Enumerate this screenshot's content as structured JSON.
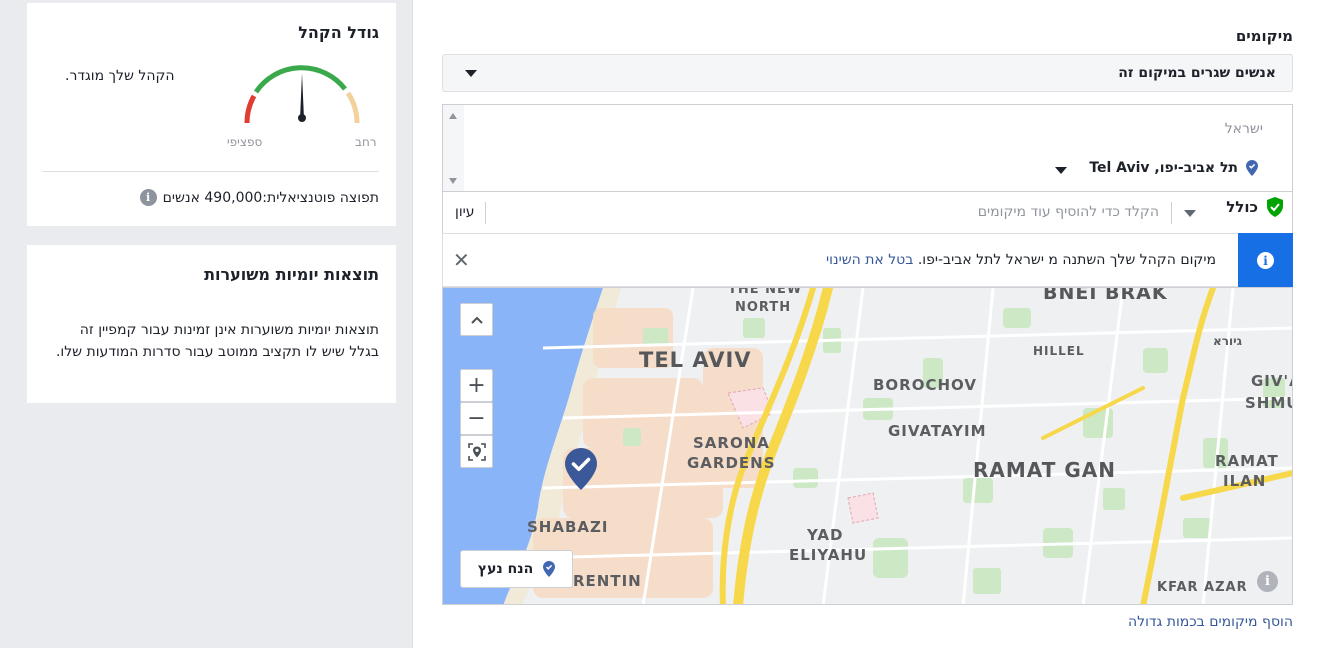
{
  "audience_size": {
    "title": "גודל הקהל",
    "description": "הקהל שלך מוגדר.",
    "gauge_left_label": "ספציפי",
    "gauge_right_label": "רחב",
    "gauge_level": 0.5,
    "potential_reach": "תפוצה פוטנציאלית:490,000 אנשים"
  },
  "daily_results": {
    "title": "תוצאות יומיות משוערות",
    "text": "תוצאות יומיות משוערות אינן זמינות עבור קמפיין זה בגלל שיש לו תקציב ממוטב עבור סדרות המודעות שלו."
  },
  "locations": {
    "title": "מיקומים",
    "type_select": "אנשים שגרים במיקום זה",
    "country": "ישראל",
    "selected_item": "תל אביב-יפו, Tel Aviv",
    "include_label": "כולל",
    "add_placeholder": "הקלד כדי להוסיף עוד מיקומים",
    "browse_label": "עיון",
    "notice_text": "מיקום הקהל שלך השתנה מ ישראל לתל אביב-יפו.",
    "notice_undo": "בטל את השינוי",
    "drop_pin": "הנח נעץ",
    "bulk_link": "הוסף מיקומים בכמות גדולה"
  },
  "map": {
    "labels": {
      "the_new_north_1": "THE NEW",
      "the_new_north_2": "NORTH",
      "tel_aviv": "TEL AVIV",
      "bnei_brak": "BNEI BRAK",
      "hillel": "HILLEL",
      "giora": "גיורא",
      "givat_1": "GIV'AT",
      "givat_2": "SHMUEL",
      "borochov": "BOROCHOV",
      "sarona_1": "SARONA",
      "sarona_2": "GARDENS",
      "givatayim": "GIVATAYIM",
      "ramat_gan": "RAMAT GAN",
      "ramat_ilan_1": "RAMAT",
      "ramat_ilan_2": "ILAN",
      "shabazi": "SHABAZI",
      "yad_1": "YAD",
      "yad_2": "ELIYAHU",
      "florentin": "RENTIN",
      "kfar_azar": "KFAR AZAR"
    },
    "colors": {
      "sea": "#8ab4f8",
      "land": "#eef0f2",
      "highway": "#f7d84a",
      "park": "#cde8c4",
      "marker": "#3b5998"
    }
  },
  "icons": {
    "info": "i",
    "close": "✕",
    "zoom_in": "+",
    "zoom_out": "−",
    "up": "︿"
  }
}
